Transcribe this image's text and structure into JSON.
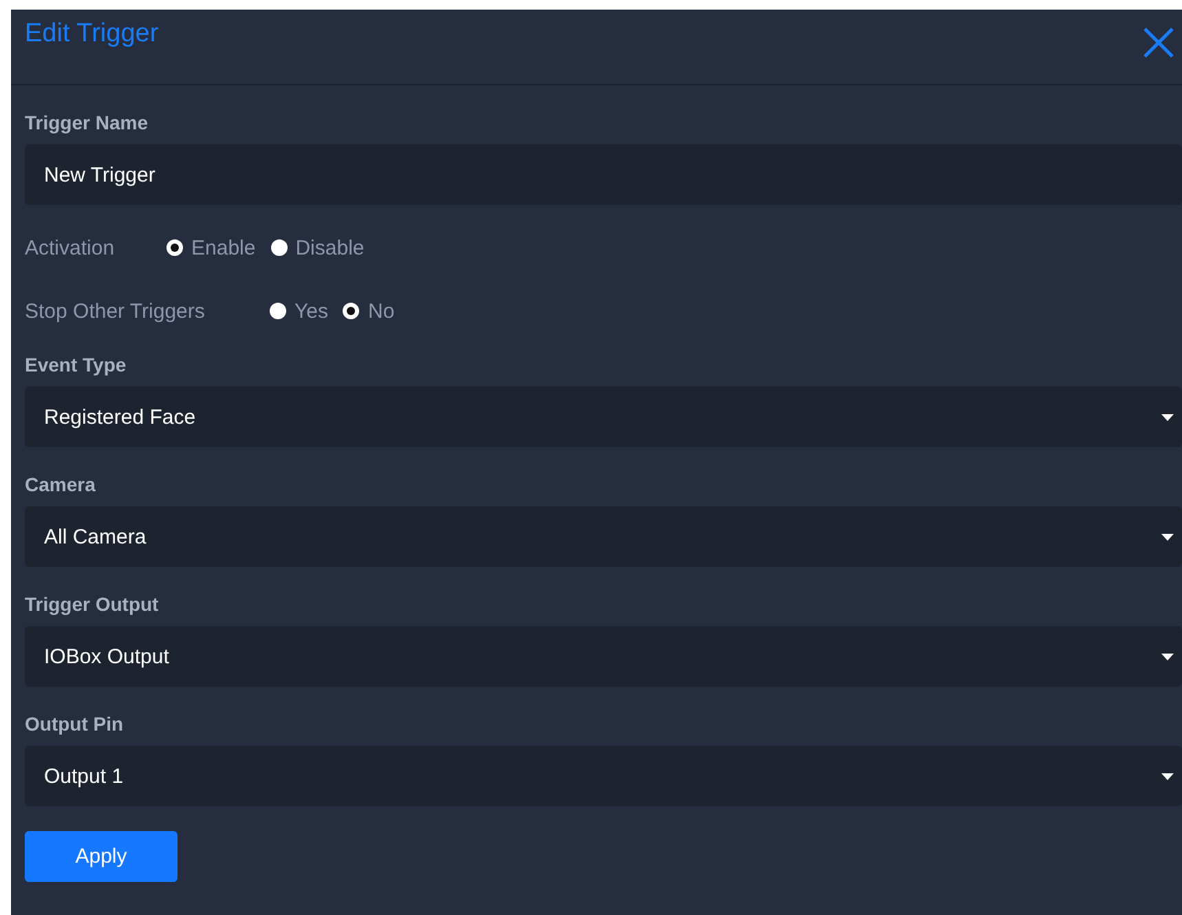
{
  "dialog": {
    "title": "Edit Trigger"
  },
  "trigger_name": {
    "label": "Trigger Name",
    "value": "New Trigger"
  },
  "radio_groups": [
    {
      "label": "Activation",
      "options": [
        {
          "label": "Enable",
          "selected": true
        },
        {
          "label": "Disable",
          "selected": false
        }
      ]
    },
    {
      "label": "Stop Other Triggers",
      "options": [
        {
          "label": "Yes",
          "selected": false
        },
        {
          "label": "No",
          "selected": true
        }
      ]
    }
  ],
  "selects": [
    {
      "label": "Event Type",
      "value": "Registered Face"
    },
    {
      "label": "Camera",
      "value": "All Camera"
    },
    {
      "label": "Trigger Output",
      "value": "IOBox Output"
    },
    {
      "label": "Output Pin",
      "value": "Output 1"
    }
  ],
  "apply_button": "Apply"
}
